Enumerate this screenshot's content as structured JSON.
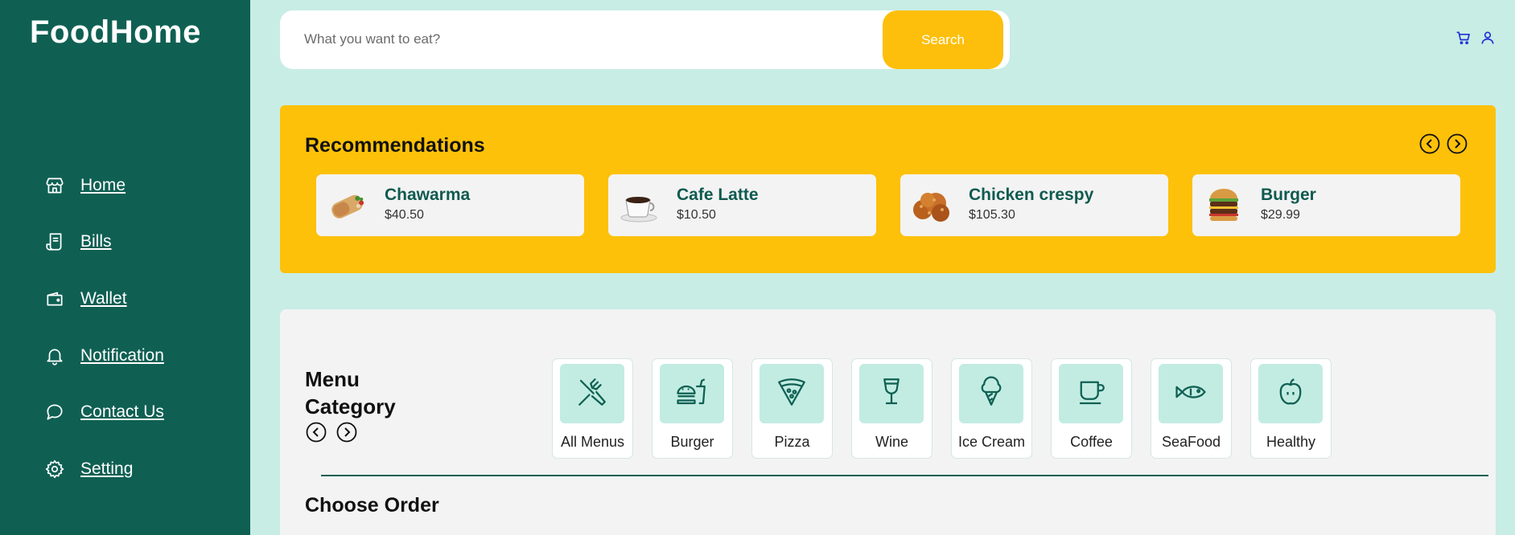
{
  "app": {
    "name": "FoodHome"
  },
  "sidebar": {
    "items": [
      {
        "label": "Home",
        "icon": "store-icon"
      },
      {
        "label": "Bills",
        "icon": "receipt-icon"
      },
      {
        "label": "Wallet",
        "icon": "wallet-icon"
      },
      {
        "label": "Notification",
        "icon": "bell-icon"
      },
      {
        "label": "Contact Us",
        "icon": "chat-icon"
      },
      {
        "label": "Setting",
        "icon": "gear-icon"
      }
    ]
  },
  "search": {
    "placeholder": "What you want to eat?",
    "value": "",
    "button_label": "Search"
  },
  "header_icons": [
    "cart-icon",
    "user-icon"
  ],
  "recommendations": {
    "title": "Recommendations",
    "items": [
      {
        "name": "Chawarma",
        "price": "$40.50"
      },
      {
        "name": "Cafe Latte",
        "price": "$10.50"
      },
      {
        "name": "Chicken crespy",
        "price": "$105.30"
      },
      {
        "name": "Burger",
        "price": "$29.99"
      }
    ]
  },
  "menu": {
    "title": "Menu Category",
    "categories": [
      {
        "label": "All Menus",
        "icon": "utensils-icon"
      },
      {
        "label": "Burger",
        "icon": "burger-icon"
      },
      {
        "label": "Pizza",
        "icon": "pizza-icon"
      },
      {
        "label": "Wine",
        "icon": "wine-icon"
      },
      {
        "label": "Ice Cream",
        "icon": "ice-cream-icon"
      },
      {
        "label": "Coffee",
        "icon": "coffee-icon"
      },
      {
        "label": "SeaFood",
        "icon": "fish-icon"
      },
      {
        "label": "Healthy",
        "icon": "apple-icon"
      }
    ]
  },
  "order": {
    "title": "Choose Order"
  },
  "colors": {
    "sidebar": "#0f6053",
    "background": "#c8ede5",
    "accent": "#fdc10a",
    "category_tile": "#c2ece2",
    "link_icon": "#1f2fd6"
  }
}
